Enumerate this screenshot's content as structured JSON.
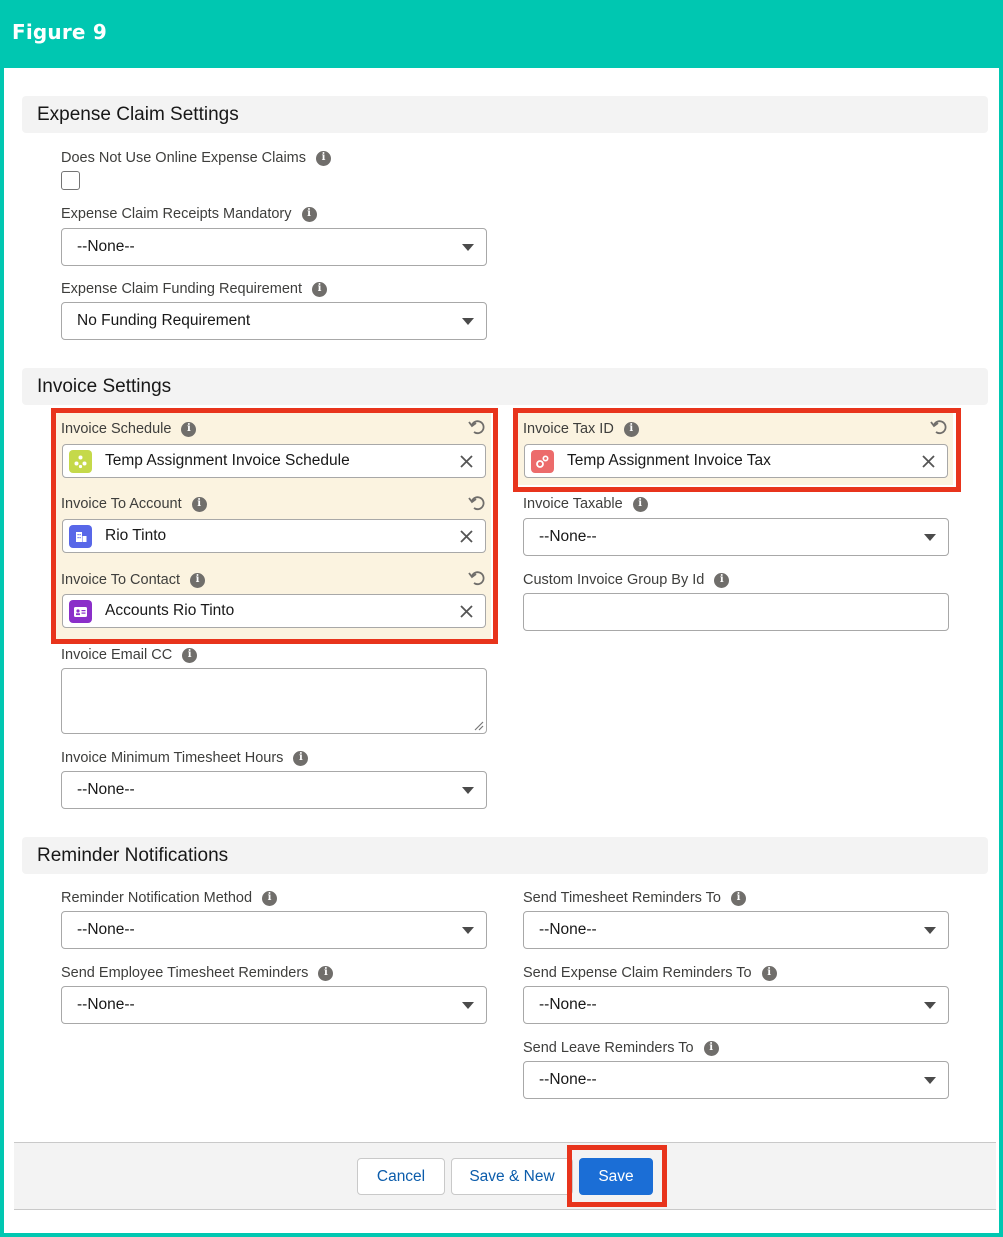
{
  "figure_title": "Figure 9",
  "sections": {
    "expense": {
      "title": "Expense Claim Settings"
    },
    "invoice": {
      "title": "Invoice Settings"
    },
    "reminders": {
      "title": "Reminder Notifications"
    }
  },
  "fields": {
    "does_not_use_online_claims": {
      "label": "Does Not Use Online Expense Claims",
      "checked": false
    },
    "receipts_mandatory": {
      "label": "Expense Claim Receipts Mandatory",
      "value": "--None--"
    },
    "funding_requirement": {
      "label": "Expense Claim Funding Requirement",
      "value": "No Funding Requirement"
    },
    "invoice_schedule": {
      "label": "Invoice Schedule",
      "value": "Temp Assignment Invoice Schedule",
      "icon": "schedule-object-icon",
      "icon_color": "#c5d94a"
    },
    "invoice_to_account": {
      "label": "Invoice To Account",
      "value": "Rio Tinto",
      "icon": "account-object-icon",
      "icon_color": "#5867e8"
    },
    "invoice_to_contact": {
      "label": "Invoice To Contact",
      "value": "Accounts Rio Tinto",
      "icon": "contact-object-icon",
      "icon_color": "#8b2fc9"
    },
    "invoice_email_cc": {
      "label": "Invoice Email CC",
      "value": ""
    },
    "invoice_min_hours": {
      "label": "Invoice Minimum Timesheet Hours",
      "value": "--None--"
    },
    "invoice_tax_id": {
      "label": "Invoice Tax ID",
      "value": "Temp Assignment Invoice Tax",
      "icon": "tax-object-icon",
      "icon_color": "#ec6b6b"
    },
    "invoice_taxable": {
      "label": "Invoice Taxable",
      "value": "--None--"
    },
    "custom_invoice_group": {
      "label": "Custom Invoice Group By Id",
      "value": ""
    },
    "reminder_method": {
      "label": "Reminder Notification Method",
      "value": "--None--"
    },
    "send_employee_timesheet": {
      "label": "Send Employee Timesheet Reminders",
      "value": "--None--"
    },
    "timesheet_reminders_to": {
      "label": "Send Timesheet Reminders To",
      "value": "--None--"
    },
    "expense_reminders_to": {
      "label": "Send Expense Claim Reminders To",
      "value": "--None--"
    },
    "leave_reminders_to": {
      "label": "Send Leave Reminders To",
      "value": "--None--"
    }
  },
  "info_icon_glyph": "i",
  "buttons": {
    "cancel": "Cancel",
    "save_new": "Save & New",
    "save": "Save"
  },
  "colors": {
    "frame": "#00c7b1",
    "highlight": "#e8341c",
    "changed_field": "#fbf3e0",
    "brand": "#1b6ed6"
  }
}
